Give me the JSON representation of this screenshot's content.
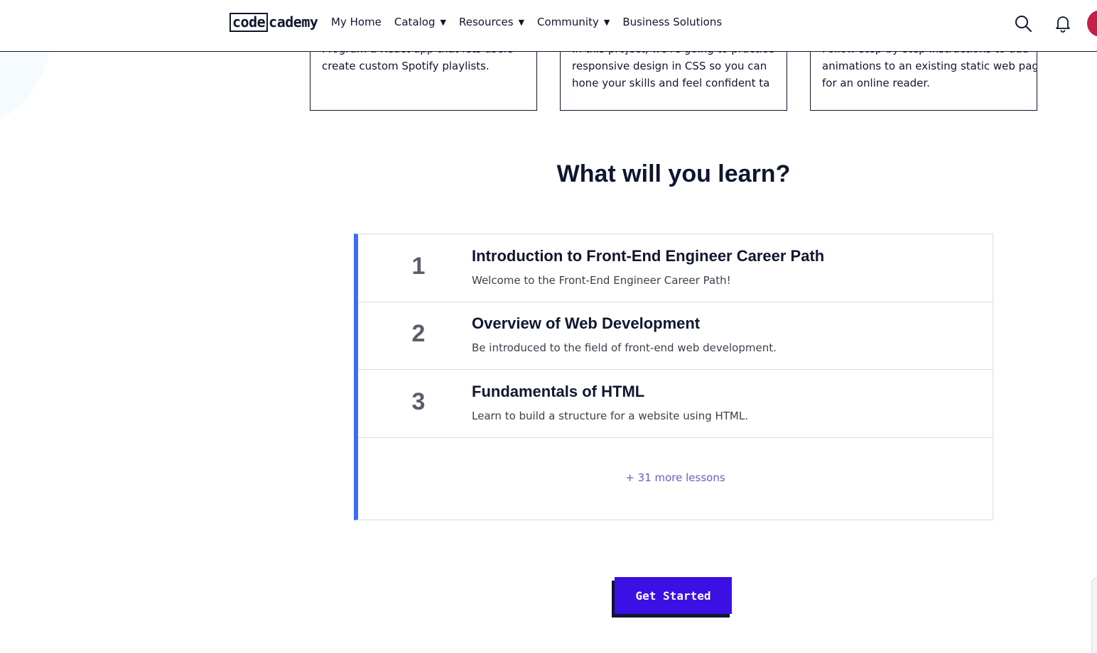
{
  "header": {
    "logo_box": "code",
    "logo_rest": "cademy",
    "nav": [
      {
        "label": "My Home",
        "dropdown": false
      },
      {
        "label": "Catalog",
        "dropdown": true
      },
      {
        "label": "Resources",
        "dropdown": true
      },
      {
        "label": "Community",
        "dropdown": true
      },
      {
        "label": "Business Solutions",
        "dropdown": false
      }
    ],
    "icons": [
      "search-icon",
      "bell-icon",
      "avatar"
    ]
  },
  "projects": [
    {
      "lines": [
        "Program a React app that lets users",
        "create custom Spotify playlists."
      ]
    },
    {
      "lines": [
        "In this project, we're going to practice",
        "responsive design in CSS so you can",
        "hone your skills and feel confident ta"
      ]
    },
    {
      "lines": [
        "Follow step-by-step instructions to add",
        "animations to an existing static web page",
        "for an online reader."
      ]
    }
  ],
  "section_title": "What will you learn?",
  "lessons": [
    {
      "num": "1",
      "title": "Introduction to Front-End Engineer Career Path",
      "desc": "Welcome to the Front-End Engineer Career Path!"
    },
    {
      "num": "2",
      "title": "Overview of Web Development",
      "desc": "Be introduced to the field of front-end web development."
    },
    {
      "num": "3",
      "title": "Fundamentals of HTML",
      "desc": "Learn to build a structure for a website using HTML."
    }
  ],
  "more_lessons": "+ 31 more lessons",
  "cta": "Get Started",
  "colors": {
    "accent": "#3a10e5",
    "list_border": "#3a6cf4",
    "link": "#6a5cc7",
    "text": "#10162f"
  }
}
